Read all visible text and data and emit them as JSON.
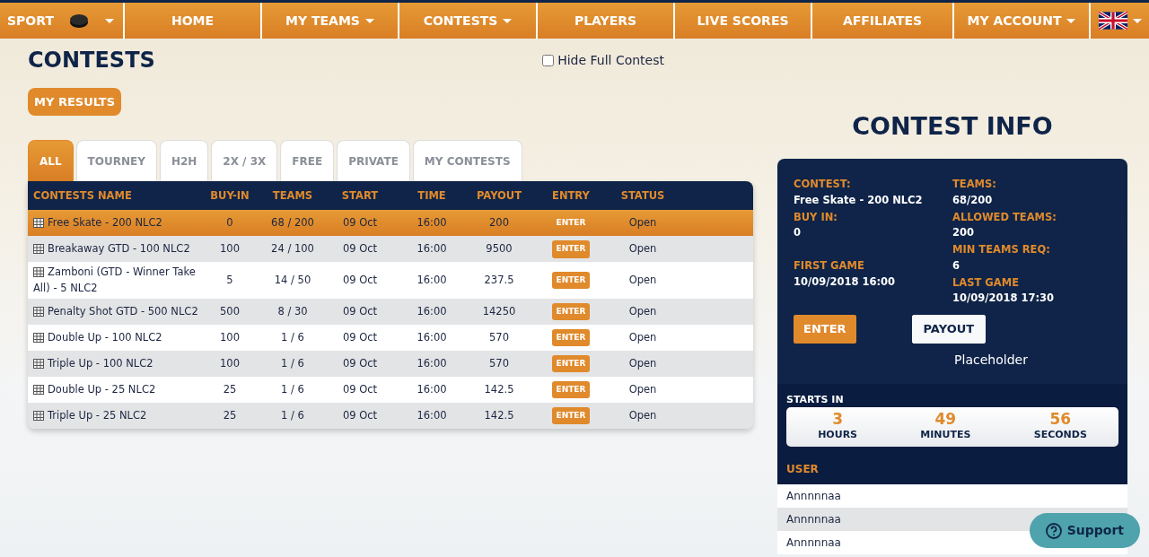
{
  "nav": [
    {
      "label": "SPORT",
      "kind": "sport",
      "dropdown": true
    },
    {
      "label": "HOME",
      "kind": "link",
      "dropdown": false
    },
    {
      "label": "MY TEAMS",
      "kind": "link",
      "dropdown": true
    },
    {
      "label": "CONTESTS",
      "kind": "link",
      "dropdown": true
    },
    {
      "label": "PLAYERS",
      "kind": "link",
      "dropdown": false
    },
    {
      "label": "LIVE SCORES",
      "kind": "link",
      "dropdown": false
    },
    {
      "label": "AFFILIATES",
      "kind": "link",
      "dropdown": false
    },
    {
      "label": "MY ACCOUNT",
      "kind": "link",
      "dropdown": true
    },
    {
      "kind": "language",
      "dropdown": true
    }
  ],
  "page_title": "CONTESTS",
  "hide_full": {
    "label": "Hide Full Contest",
    "checked": false
  },
  "my_results": "MY RESULTS",
  "tabs": [
    {
      "label": "ALL",
      "selected": true
    },
    {
      "label": "TOURNEY",
      "selected": false
    },
    {
      "label": "H2H",
      "selected": false
    },
    {
      "label": "2X / 3X",
      "selected": false
    },
    {
      "label": "FREE",
      "selected": false
    },
    {
      "label": "PRIVATE",
      "selected": false
    },
    {
      "label": "MY CONTESTS",
      "selected": false
    }
  ],
  "table": {
    "columns": [
      "CONTESTS NAME",
      "BUY-IN",
      "TEAMS",
      "START",
      "TIME",
      "PAYOUT",
      "ENTRY",
      "STATUS"
    ],
    "rows": [
      {
        "name": "Free Skate - 200 NLC2",
        "buy_in": "0",
        "teams": "68 / 200",
        "start": "09 Oct",
        "time": "16:00",
        "payout": "200",
        "entry": "ENTER",
        "status": "Open",
        "selected": true
      },
      {
        "name": "Breakaway GTD - 100 NLC2",
        "buy_in": "100",
        "teams": "24 / 100",
        "start": "09 Oct",
        "time": "16:00",
        "payout": "9500",
        "entry": "ENTER",
        "status": "Open",
        "selected": false
      },
      {
        "name": "Zamboni (GTD - Winner Take All) - 5 NLC2",
        "buy_in": "5",
        "teams": "14 / 50",
        "start": "09 Oct",
        "time": "16:00",
        "payout": "237.5",
        "entry": "ENTER",
        "status": "Open",
        "selected": false
      },
      {
        "name": "Penalty Shot GTD - 500 NLC2",
        "buy_in": "500",
        "teams": "8 / 30",
        "start": "09 Oct",
        "time": "16:00",
        "payout": "14250",
        "entry": "ENTER",
        "status": "Open",
        "selected": false
      },
      {
        "name": "Double Up - 100 NLC2",
        "buy_in": "100",
        "teams": "1 / 6",
        "start": "09 Oct",
        "time": "16:00",
        "payout": "570",
        "entry": "ENTER",
        "status": "Open",
        "selected": false
      },
      {
        "name": "Triple Up - 100 NLC2",
        "buy_in": "100",
        "teams": "1 / 6",
        "start": "09 Oct",
        "time": "16:00",
        "payout": "570",
        "entry": "ENTER",
        "status": "Open",
        "selected": false
      },
      {
        "name": "Double Up - 25 NLC2",
        "buy_in": "25",
        "teams": "1 / 6",
        "start": "09 Oct",
        "time": "16:00",
        "payout": "142.5",
        "entry": "ENTER",
        "status": "Open",
        "selected": false
      },
      {
        "name": "Triple Up - 25 NLC2",
        "buy_in": "25",
        "teams": "1 / 6",
        "start": "09 Oct",
        "time": "16:00",
        "payout": "142.5",
        "entry": "ENTER",
        "status": "Open",
        "selected": false
      }
    ]
  },
  "contest_info": {
    "title": "CONTEST INFO",
    "left": [
      {
        "label": "CONTEST:",
        "value": "Free Skate - 200 NLC2"
      },
      {
        "label": "BUY IN:",
        "value": "0"
      },
      {
        "label": "FIRST GAME",
        "value": "10/09/2018 16:00"
      }
    ],
    "right": [
      {
        "label": "TEAMS:",
        "value": "68/200"
      },
      {
        "label": "ALLOWED TEAMS:",
        "value": "200"
      },
      {
        "label": "MIN TEAMS REQ:",
        "value": "6"
      },
      {
        "label": "LAST GAME",
        "value": "10/09/2018 17:30"
      }
    ],
    "enter": "ENTER",
    "payout": "PAYOUT",
    "placeholder_text": "Placeholder",
    "starts_in": "STARTS IN",
    "countdown": [
      {
        "value": "3",
        "unit": "HOURS"
      },
      {
        "value": "49",
        "unit": "MINUTES"
      },
      {
        "value": "56",
        "unit": "SECONDS"
      }
    ],
    "user_heading": "USER",
    "users": [
      "Annnnnaa",
      "Annnnnaa",
      "Annnnnaa"
    ]
  },
  "support": "Support"
}
